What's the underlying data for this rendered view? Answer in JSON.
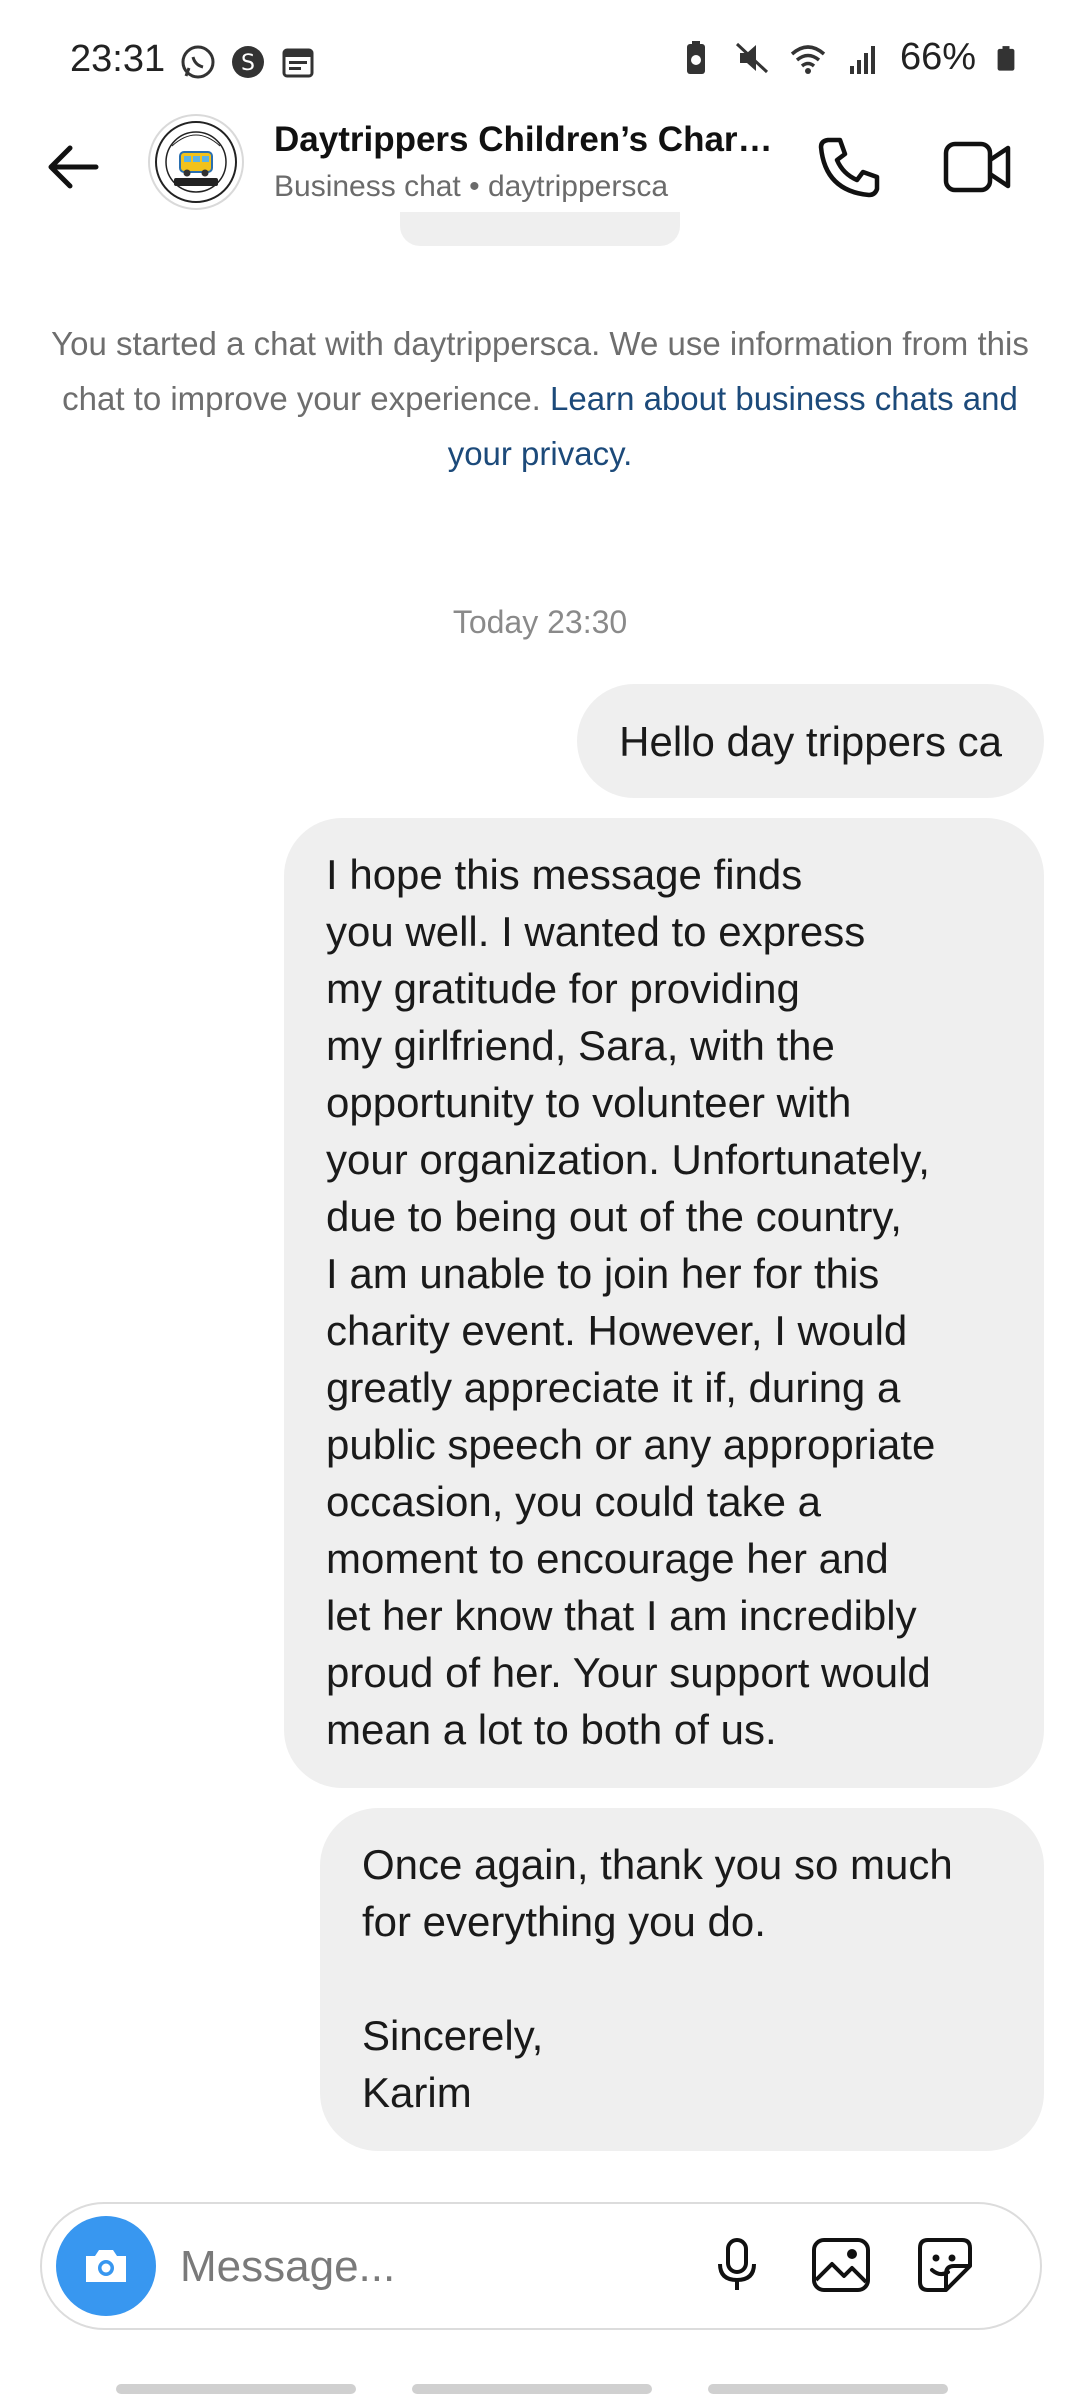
{
  "status_bar": {
    "time": "23:31",
    "battery_text": "66%",
    "icons": [
      "whatsapp-icon",
      "skype-icon",
      "calendar-icon",
      "battery-saver-icon",
      "mute-icon",
      "wifi-icon",
      "signal-icon",
      "battery-icon"
    ]
  },
  "header": {
    "title": "Daytrippers Children’s Chari…",
    "subtitle": "Business chat • daytrippersca",
    "avatar_top_text": "DAYTRIPPERS",
    "avatar_bottom_text": "Children's Charity"
  },
  "notice": {
    "text": "You started a chat with daytrippersca. We use information from this chat to improve your experience. ",
    "link": "Learn about business chats and your privacy."
  },
  "timestamp": "Today 23:30",
  "messages": [
    {
      "text": "Hello day trippers ca"
    },
    {
      "text": "I hope this message finds\nyou well. I wanted to express\nmy gratitude for providing\nmy girlfriend, Sara, with the\nopportunity to volunteer with\nyour organization. Unfortunately,\ndue to being out of the country,\nI am unable to join her for this\ncharity event. However, I would\ngreatly appreciate it if, during a\npublic speech or any appropriate\noccasion, you could take a\nmoment to encourage her and\nlet her know that I am incredibly\nproud of her. Your support would\nmean a lot to both of us."
    },
    {
      "text": "Once again, thank you so much\nfor everything you do.\n\nSincerely,\nKarim"
    }
  ],
  "composer": {
    "placeholder": "Message..."
  },
  "colors": {
    "accent": "#3897f0",
    "bubble": "#efefef",
    "link": "#1c4a7a"
  }
}
